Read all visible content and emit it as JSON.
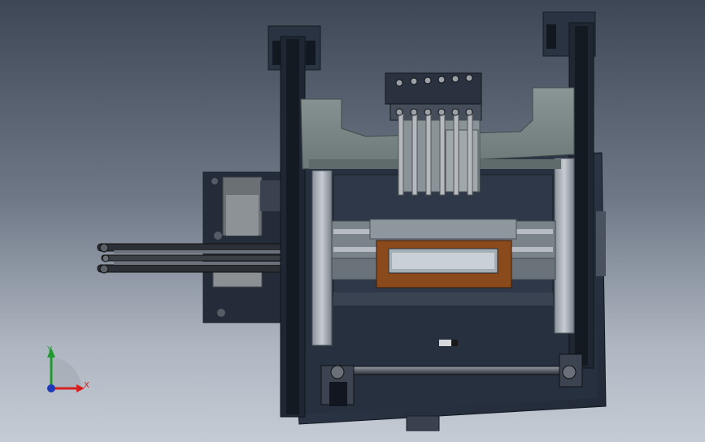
{
  "scene": {
    "subject": "cad-assembly-3d-model",
    "view": "isometric"
  },
  "triad": {
    "x_label": "X",
    "y_label": "Y",
    "colors": {
      "x": "#d42020",
      "y": "#1f9a2e",
      "z": "#1f3ab8"
    }
  },
  "colors": {
    "background_top": "#3e4756",
    "background_bottom": "#c4cbd4",
    "frame": "#2b3444",
    "plate": "#7e8a8a",
    "copper_tray": "#8a4a1c"
  }
}
